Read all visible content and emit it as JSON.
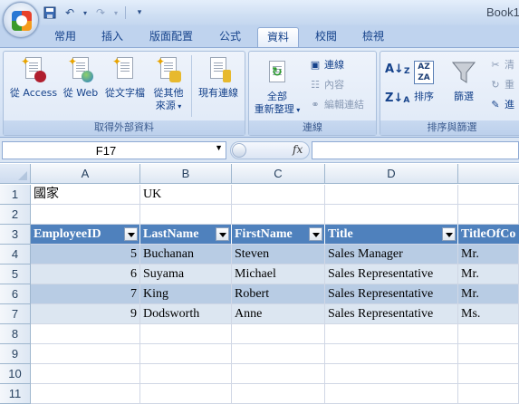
{
  "window": {
    "book_title": "Book1"
  },
  "tabs": [
    "常用",
    "插入",
    "版面配置",
    "公式",
    "資料",
    "校閱",
    "檢視"
  ],
  "active_tab": "資料",
  "ribbon": {
    "external_data": {
      "label": "取得外部資料",
      "from_access": "從 Access",
      "from_web": "從 Web",
      "from_text": "從文字檔",
      "from_other_1": "從其他",
      "from_other_2": "來源",
      "existing": "現有連線"
    },
    "connections": {
      "label": "連線",
      "refresh_1": "全部",
      "refresh_2": "重新整理",
      "connections": "連線",
      "properties": "內容",
      "edit_links": "編輯連結"
    },
    "sort_filter": {
      "label": "排序與篩選",
      "sort": "排序",
      "filter": "篩選",
      "clear": "清",
      "reapply": "重",
      "advanced": "進"
    }
  },
  "formula_bar": {
    "name_box": "F17",
    "fx": "fx",
    "formula": ""
  },
  "grid": {
    "columns": [
      "A",
      "B",
      "C",
      "D"
    ],
    "rows": [
      "1",
      "2",
      "3",
      "4",
      "5",
      "6",
      "7",
      "8",
      "9",
      "10",
      "11"
    ],
    "r1": {
      "a": "國家",
      "b": "UK"
    },
    "headers": [
      "EmployeeID",
      "LastName",
      "FirstName",
      "Title",
      "TitleOfCo"
    ],
    "data": [
      {
        "id": "5",
        "last": "Buchanan",
        "first": "Steven",
        "title": "Sales Manager",
        "toc": "Mr."
      },
      {
        "id": "6",
        "last": "Suyama",
        "first": "Michael",
        "title": "Sales Representative",
        "toc": "Mr."
      },
      {
        "id": "7",
        "last": "King",
        "first": "Robert",
        "title": "Sales Representative",
        "toc": "Mr."
      },
      {
        "id": "9",
        "last": "Dodsworth",
        "first": "Anne",
        "title": "Sales Representative",
        "toc": "Ms."
      }
    ]
  },
  "colors": {
    "table_header": "#4f81bd",
    "band_dark": "#b8cce4",
    "band_light": "#dce6f1"
  }
}
